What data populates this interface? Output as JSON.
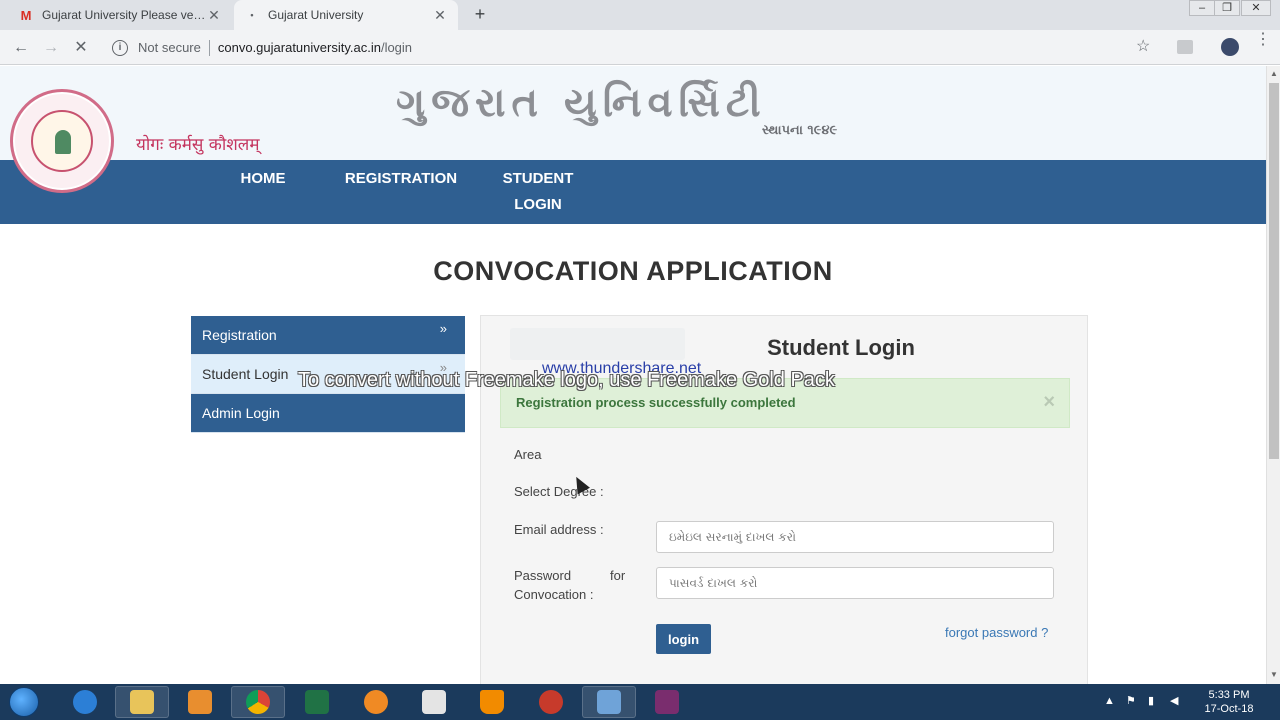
{
  "browser": {
    "tabs": [
      {
        "title": "Gujarat University Please verify y",
        "favicon": "gmail-icon",
        "active": false
      },
      {
        "title": "Gujarat University",
        "favicon": "loading-dot-icon",
        "active": true
      }
    ],
    "new_tab_label": "+",
    "close_glyph": "✕",
    "security_label": "Not secure",
    "url_host": "convo.gujaratuniversity.ac.in",
    "url_path": "/login"
  },
  "site": {
    "brand_title": "ગુજરાત યુનિવર્સિટી",
    "brand_subtitle": "સ્થાપના ૧૯૪૯",
    "motto": "योगः कर्मसु कौशलम्",
    "nav": [
      {
        "label": "HOME"
      },
      {
        "label": "REGISTRATION"
      },
      {
        "label": "STUDENT LOGIN"
      }
    ]
  },
  "page": {
    "title": "CONVOCATION APPLICATION",
    "side_menu": [
      {
        "label": "Registration",
        "active": false
      },
      {
        "label": "Student Login",
        "active": true
      },
      {
        "label": "Admin Login",
        "active": false
      }
    ],
    "side_chevron": "»",
    "login": {
      "heading": "Student Login",
      "alert": "Registration process successfully completed",
      "alert_close": "×",
      "area_label": "Area",
      "degree_label": "Select Degree :",
      "email_label": "Email address :",
      "email_placeholder": "ઇમેઇલ સરનામું દાખલ કરો",
      "password_label_1": "Password",
      "password_label_1b": "for",
      "password_label_2": "Convocation :",
      "password_placeholder": "પાસવર્ડ દાખલ કરો",
      "login_button": "login",
      "forgot_link": "forgot password ?"
    }
  },
  "watermark": {
    "logo_text": "To convert without Freemake logo, use Freemake Gold Pack",
    "url_text": "www.thundershare.net"
  },
  "taskbar": {
    "time": "5:33 PM",
    "date": "17-Oct-18"
  },
  "colors": {
    "nav_blue": "#2f5f91",
    "alert_green": "#dff0d8",
    "motto_red": "#c4355f"
  }
}
